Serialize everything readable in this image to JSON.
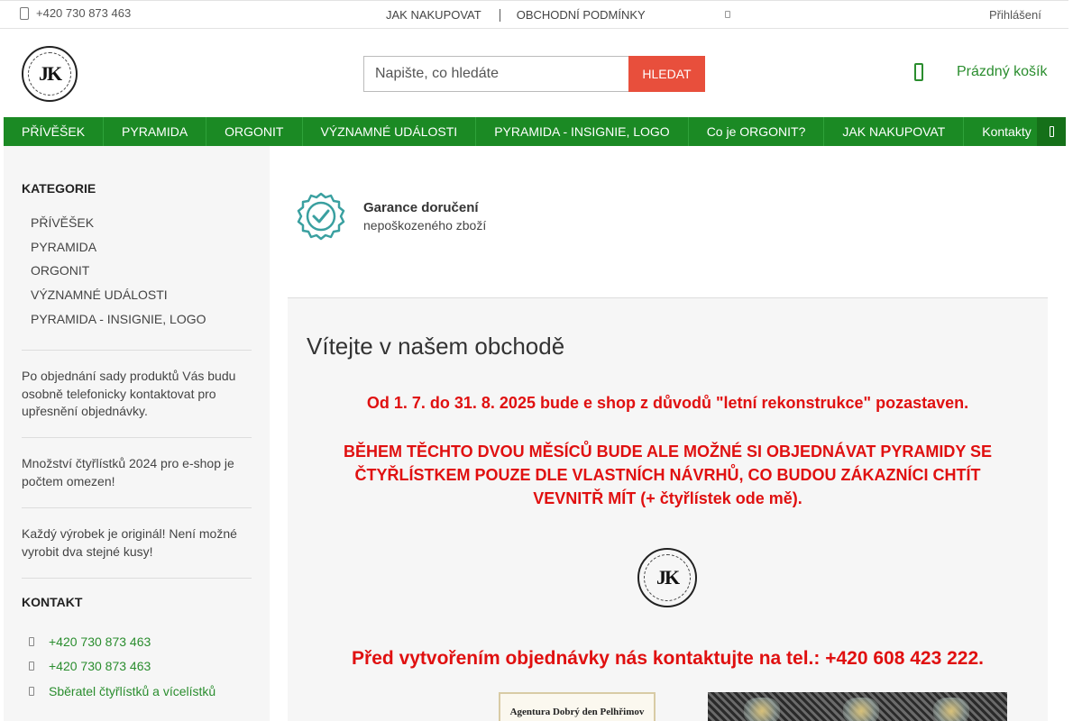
{
  "topbar": {
    "phone": "+420 730 873 463",
    "links": [
      "JAK NAKUPOVAT",
      "OBCHODNÍ PODMÍNKY"
    ],
    "login": "Přihlášení"
  },
  "header": {
    "logo_text": "JK",
    "logo_ring_text": "ČTYŘLÍSTEK PRO ŠTĚSTÍ OD ČR REKORDMANA",
    "search": {
      "placeholder": "Napište, co hledáte",
      "button": "HLEDAT"
    },
    "cart": "Prázdný košík"
  },
  "nav": {
    "items": [
      "PŘÍVĚŠEK",
      "PYRAMIDA",
      "ORGONIT",
      "VÝZNAMNÉ UDÁLOSTI",
      "PYRAMIDA - INSIGNIE, LOGO",
      "Co je ORGONIT?",
      "JAK NAKUPOVAT",
      "Kontakty"
    ]
  },
  "sidebar": {
    "categories_title": "KATEGORIE",
    "categories": [
      "PŘÍVĚŠEK",
      "PYRAMIDA",
      "ORGONIT",
      "VÝZNAMNÉ UDÁLOSTI",
      "PYRAMIDA - INSIGNIE, LOGO"
    ],
    "notes": [
      "Po objednání sady produktů Vás budu osobně telefonicky kontaktovat pro upřesnění objednávky.",
      "Množství čtyřlístků 2024 pro e-shop je počtem omezen!",
      "Každý výrobek je originál! Není možné vyrobit dva stejné kusy!"
    ],
    "contact_title": "KONTAKT",
    "contacts": [
      "+420 730 873 463",
      "+420 730 873 463",
      "Sběratel čtyřlístků a vícelístků"
    ]
  },
  "guarantee": {
    "title": "Garance doručení",
    "subtitle": "nepoškozeného zboží"
  },
  "welcome": {
    "title": "Vítejte v našem obchodě",
    "notice1": "Od 1. 7. do 31. 8. 2025 bude e shop z důvodů \"letní rekonstrukce\" pozastaven.",
    "notice2": "BĚHEM TĚCHTO DVOU MĚSÍCŮ BUDE ALE MOŽNÉ SI OBJEDNÁVAT PYRAMIDY SE ČTYŘLÍSTKEM POUZE DLE VLASTNÍCH NÁVRHŮ, CO BUDOU ZÁKAZNÍCI CHTÍT VEVNITŘ MÍT (+ čtyřlístek ode mě).",
    "contact_notice": "Před vytvořením objednávky nás kontaktujte na tel.: +420 608 423 222.",
    "certificate_text": "Agentura Dobrý den Pelhřimov"
  },
  "colors": {
    "accent_green": "#1b8a24",
    "search_button": "#e84f3c",
    "notice_red": "#e01010",
    "guarantee_icon": "#3aa0a0"
  }
}
